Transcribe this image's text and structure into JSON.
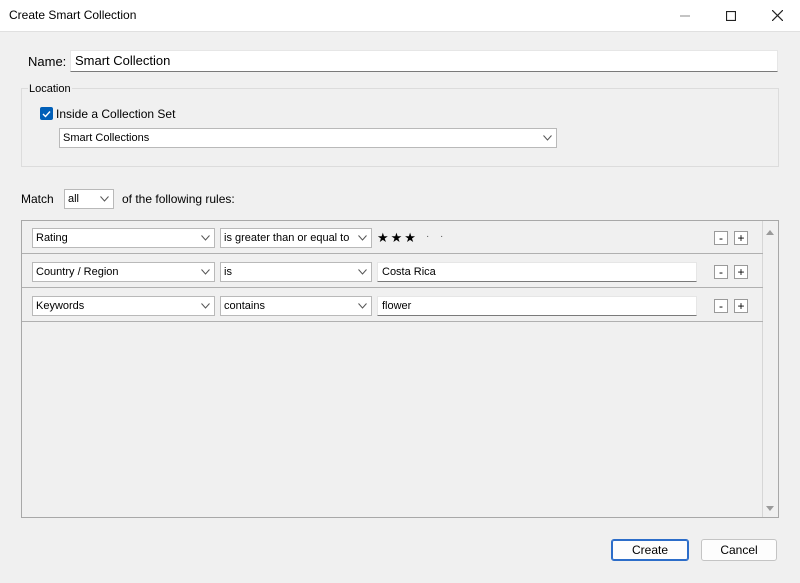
{
  "window": {
    "title": "Create Smart Collection"
  },
  "name": {
    "label": "Name:",
    "value": "Smart Collection"
  },
  "location": {
    "group_label": "Location",
    "inside_set_label": "Inside a Collection Set",
    "inside_set_checked": true,
    "collection_set": "Smart Collections"
  },
  "match": {
    "label": "Match",
    "value": "all",
    "suffix": "of the following rules:"
  },
  "rules": [
    {
      "field": "Rating",
      "operator": "is greater than or equal to",
      "value_type": "stars",
      "stars_filled": 3,
      "stars_total": 5,
      "stars_text": "★★★"
    },
    {
      "field": "Country / Region",
      "operator": "is",
      "value_type": "text",
      "value": "Costa Rica"
    },
    {
      "field": "Keywords",
      "operator": "contains",
      "value_type": "text",
      "value": "flower"
    }
  ],
  "rule_buttons": {
    "remove": "-",
    "add": "+"
  },
  "footer": {
    "create_label": "Create",
    "cancel_label": "Cancel"
  },
  "colors": {
    "accent": "#005fb8",
    "primary_border": "#2c6dc9"
  }
}
